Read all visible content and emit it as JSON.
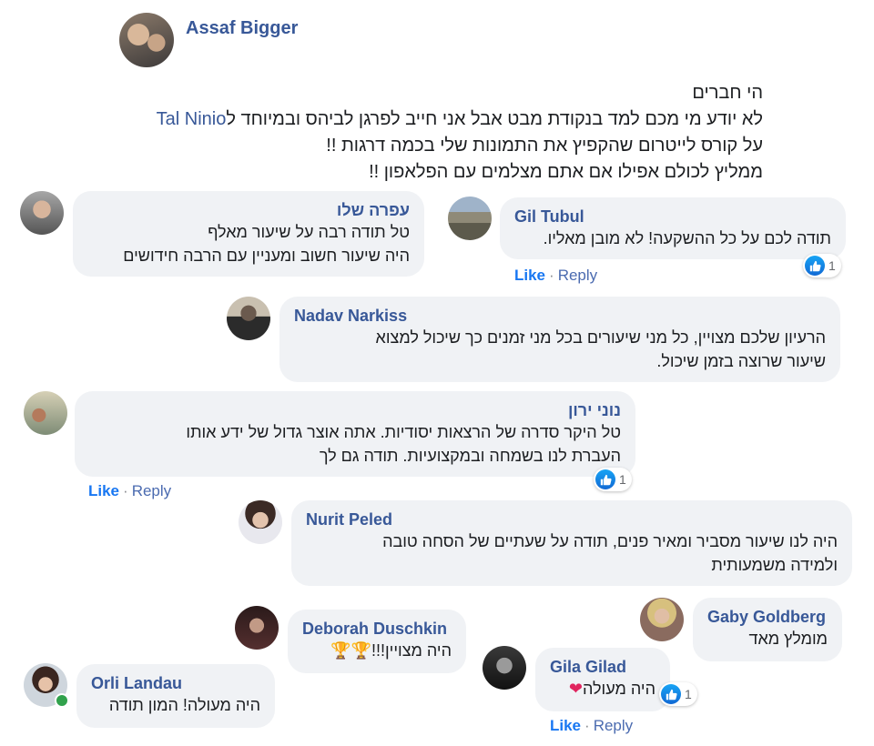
{
  "post": {
    "author": "Assaf Bigger",
    "lines": [
      "הי חברים",
      "לא יודע מי מכם למד בנקודת מבט אבל אני חייב לפרגן לביהס ובמיוחד ל",
      "על קורס לייטרום שהקפיץ את התמונות שלי בכמה דרגות !!",
      "ממליץ לכולם אפילו אם אתם מצלמים עם הפלאפון !!"
    ],
    "mention": "Tal Ninio"
  },
  "actions": {
    "like": "Like",
    "reply": "Reply",
    "separator": "·"
  },
  "comments": {
    "ofra": {
      "name": "עפרה שלו",
      "lines": [
        "טל תודה רבה על שיעור מאלף",
        "היה שיעור חשוב ומעניין עם הרבה חידושים"
      ]
    },
    "gil": {
      "name": "Gil Tubul",
      "lines": [
        "תודה לכם על כל ההשקעה! לא מובן מאליו."
      ],
      "reaction_count": "1"
    },
    "nadav": {
      "name": "Nadav Narkiss",
      "lines": [
        "הרעיון שלכם מצויין, כל מני שיעורים בכל מני זמנים כך שיכול למצוא",
        "שיעור שרוצה בזמן שיכול."
      ]
    },
    "noni": {
      "name": "נוני ירון",
      "lines": [
        "טל היקר סדרה של הרצאות יסודיות. אתה אוצר גדול של ידע אותו",
        "העברת לנו בשמחה ובמקצועיות. תודה גם לך"
      ],
      "reaction_count": "1"
    },
    "nurit": {
      "name": "Nurit Peled",
      "lines": [
        "היה לנו שיעור מסביר ומאיר פנים, תודה על שעתיים של הסחה טובה",
        "ולמידה משמעותית"
      ]
    },
    "gaby": {
      "name": "Gaby Goldberg",
      "lines": [
        "מומלץ מאד"
      ]
    },
    "deborah": {
      "name": "Deborah Duschkin",
      "lines": [
        "היה מצויין!!!"
      ],
      "emoji": "🏆🏆"
    },
    "gila": {
      "name": "Gila Gilad",
      "lines": [
        "היה מעולה"
      ],
      "reaction_count": "1"
    },
    "orli": {
      "name": "Orli Landau",
      "lines": [
        "היה מעולה! המון תודה"
      ]
    }
  }
}
